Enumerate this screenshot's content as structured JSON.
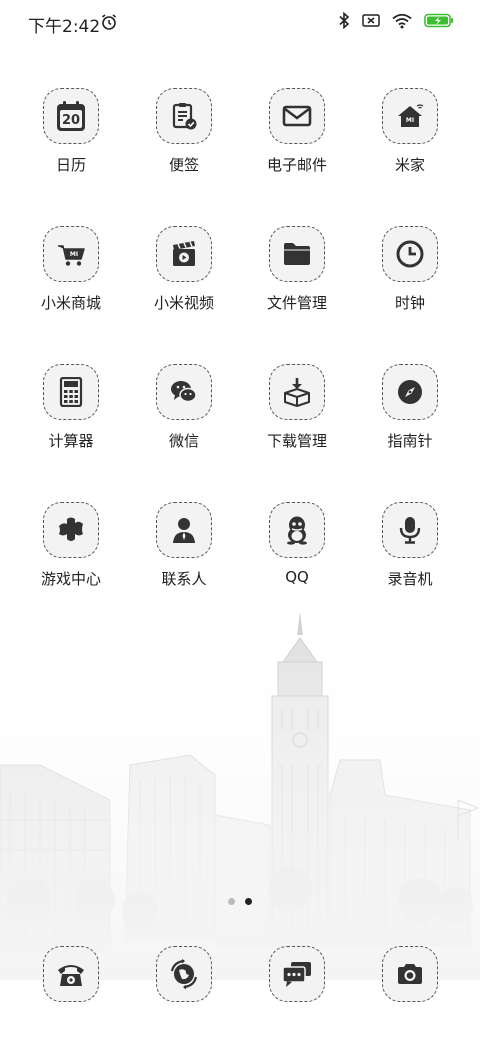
{
  "status_bar": {
    "time": "下午2:42",
    "icons": [
      "alarm-icon",
      "bluetooth-icon",
      "sim-missing-icon",
      "wifi-icon",
      "battery-charging-icon"
    ],
    "battery_color": "#3bbf2f"
  },
  "apps": [
    {
      "label": "日历",
      "icon": "calendar-icon",
      "badge": "20"
    },
    {
      "label": "便签",
      "icon": "notes-icon"
    },
    {
      "label": "电子邮件",
      "icon": "mail-icon"
    },
    {
      "label": "米家",
      "icon": "mi-home-icon",
      "badge": "MI"
    },
    {
      "label": "小米商城",
      "icon": "mi-store-icon",
      "badge": "MI"
    },
    {
      "label": "小米视频",
      "icon": "video-icon"
    },
    {
      "label": "文件管理",
      "icon": "folder-icon"
    },
    {
      "label": "时钟",
      "icon": "clock-icon"
    },
    {
      "label": "计算器",
      "icon": "calculator-icon"
    },
    {
      "label": "微信",
      "icon": "wechat-icon"
    },
    {
      "label": "下载管理",
      "icon": "download-icon"
    },
    {
      "label": "指南针",
      "icon": "compass-icon"
    },
    {
      "label": "游戏中心",
      "icon": "game-center-icon"
    },
    {
      "label": "联系人",
      "icon": "contacts-icon"
    },
    {
      "label": "QQ",
      "icon": "qq-icon"
    },
    {
      "label": "录音机",
      "icon": "recorder-icon"
    }
  ],
  "pager": {
    "pages": 2,
    "active_page": 2
  },
  "dock": [
    {
      "icon": "phone-icon"
    },
    {
      "icon": "browser-icon"
    },
    {
      "icon": "messages-icon"
    },
    {
      "icon": "camera-icon"
    }
  ],
  "wallpaper": "sketched-city-skyline"
}
